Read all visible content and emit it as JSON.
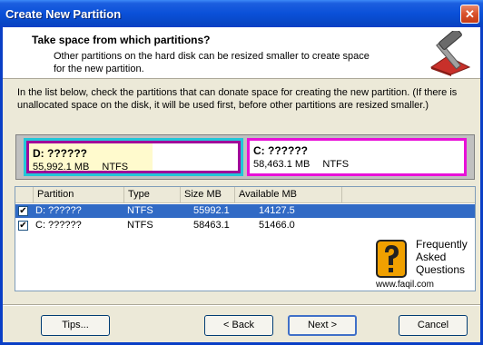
{
  "window": {
    "title": "Create New Partition",
    "close_glyph": "✕"
  },
  "header": {
    "title": "Take space from which partitions?",
    "subtitle": "Other partitions on the hard disk can be resized smaller to create space for the new partition.",
    "icon": "wizard-hammer-icon"
  },
  "instructions": "In the list below, check the partitions that can donate space for creating the new partition. (If there is unallocated space on the disk, it will be used first, before other partitions are resized smaller.)",
  "partition_map": [
    {
      "name": "D:  ??????",
      "size": "55,992.1 MB",
      "fs": "NTFS",
      "used_fraction": 0.59,
      "color": "#22c6d8"
    },
    {
      "name": "C:  ??????",
      "size": "58,463.1 MB",
      "fs": "NTFS",
      "color": "#e810d8"
    }
  ],
  "list": {
    "columns": [
      "Partition",
      "Type",
      "Size MB",
      "Available MB"
    ],
    "rows": [
      {
        "partition": "D: ??????",
        "type": "NTFS",
        "size": "55992.1",
        "available": "14127.5",
        "checked": true,
        "selected": true
      },
      {
        "partition": "C: ??????",
        "type": "NTFS",
        "size": "58463.1",
        "available": "51466.0",
        "checked": true,
        "selected": false
      }
    ]
  },
  "watermark": {
    "line1": "Frequently",
    "line2": "Asked",
    "line3": "Questions",
    "url": "www.faqil.com"
  },
  "buttons": {
    "tips": "Tips...",
    "back": "< Back",
    "next": "Next >",
    "cancel": "Cancel"
  },
  "check_glyph": "✔",
  "colors": {
    "titlebar": "#0a50d8",
    "selection": "#316ac5"
  }
}
